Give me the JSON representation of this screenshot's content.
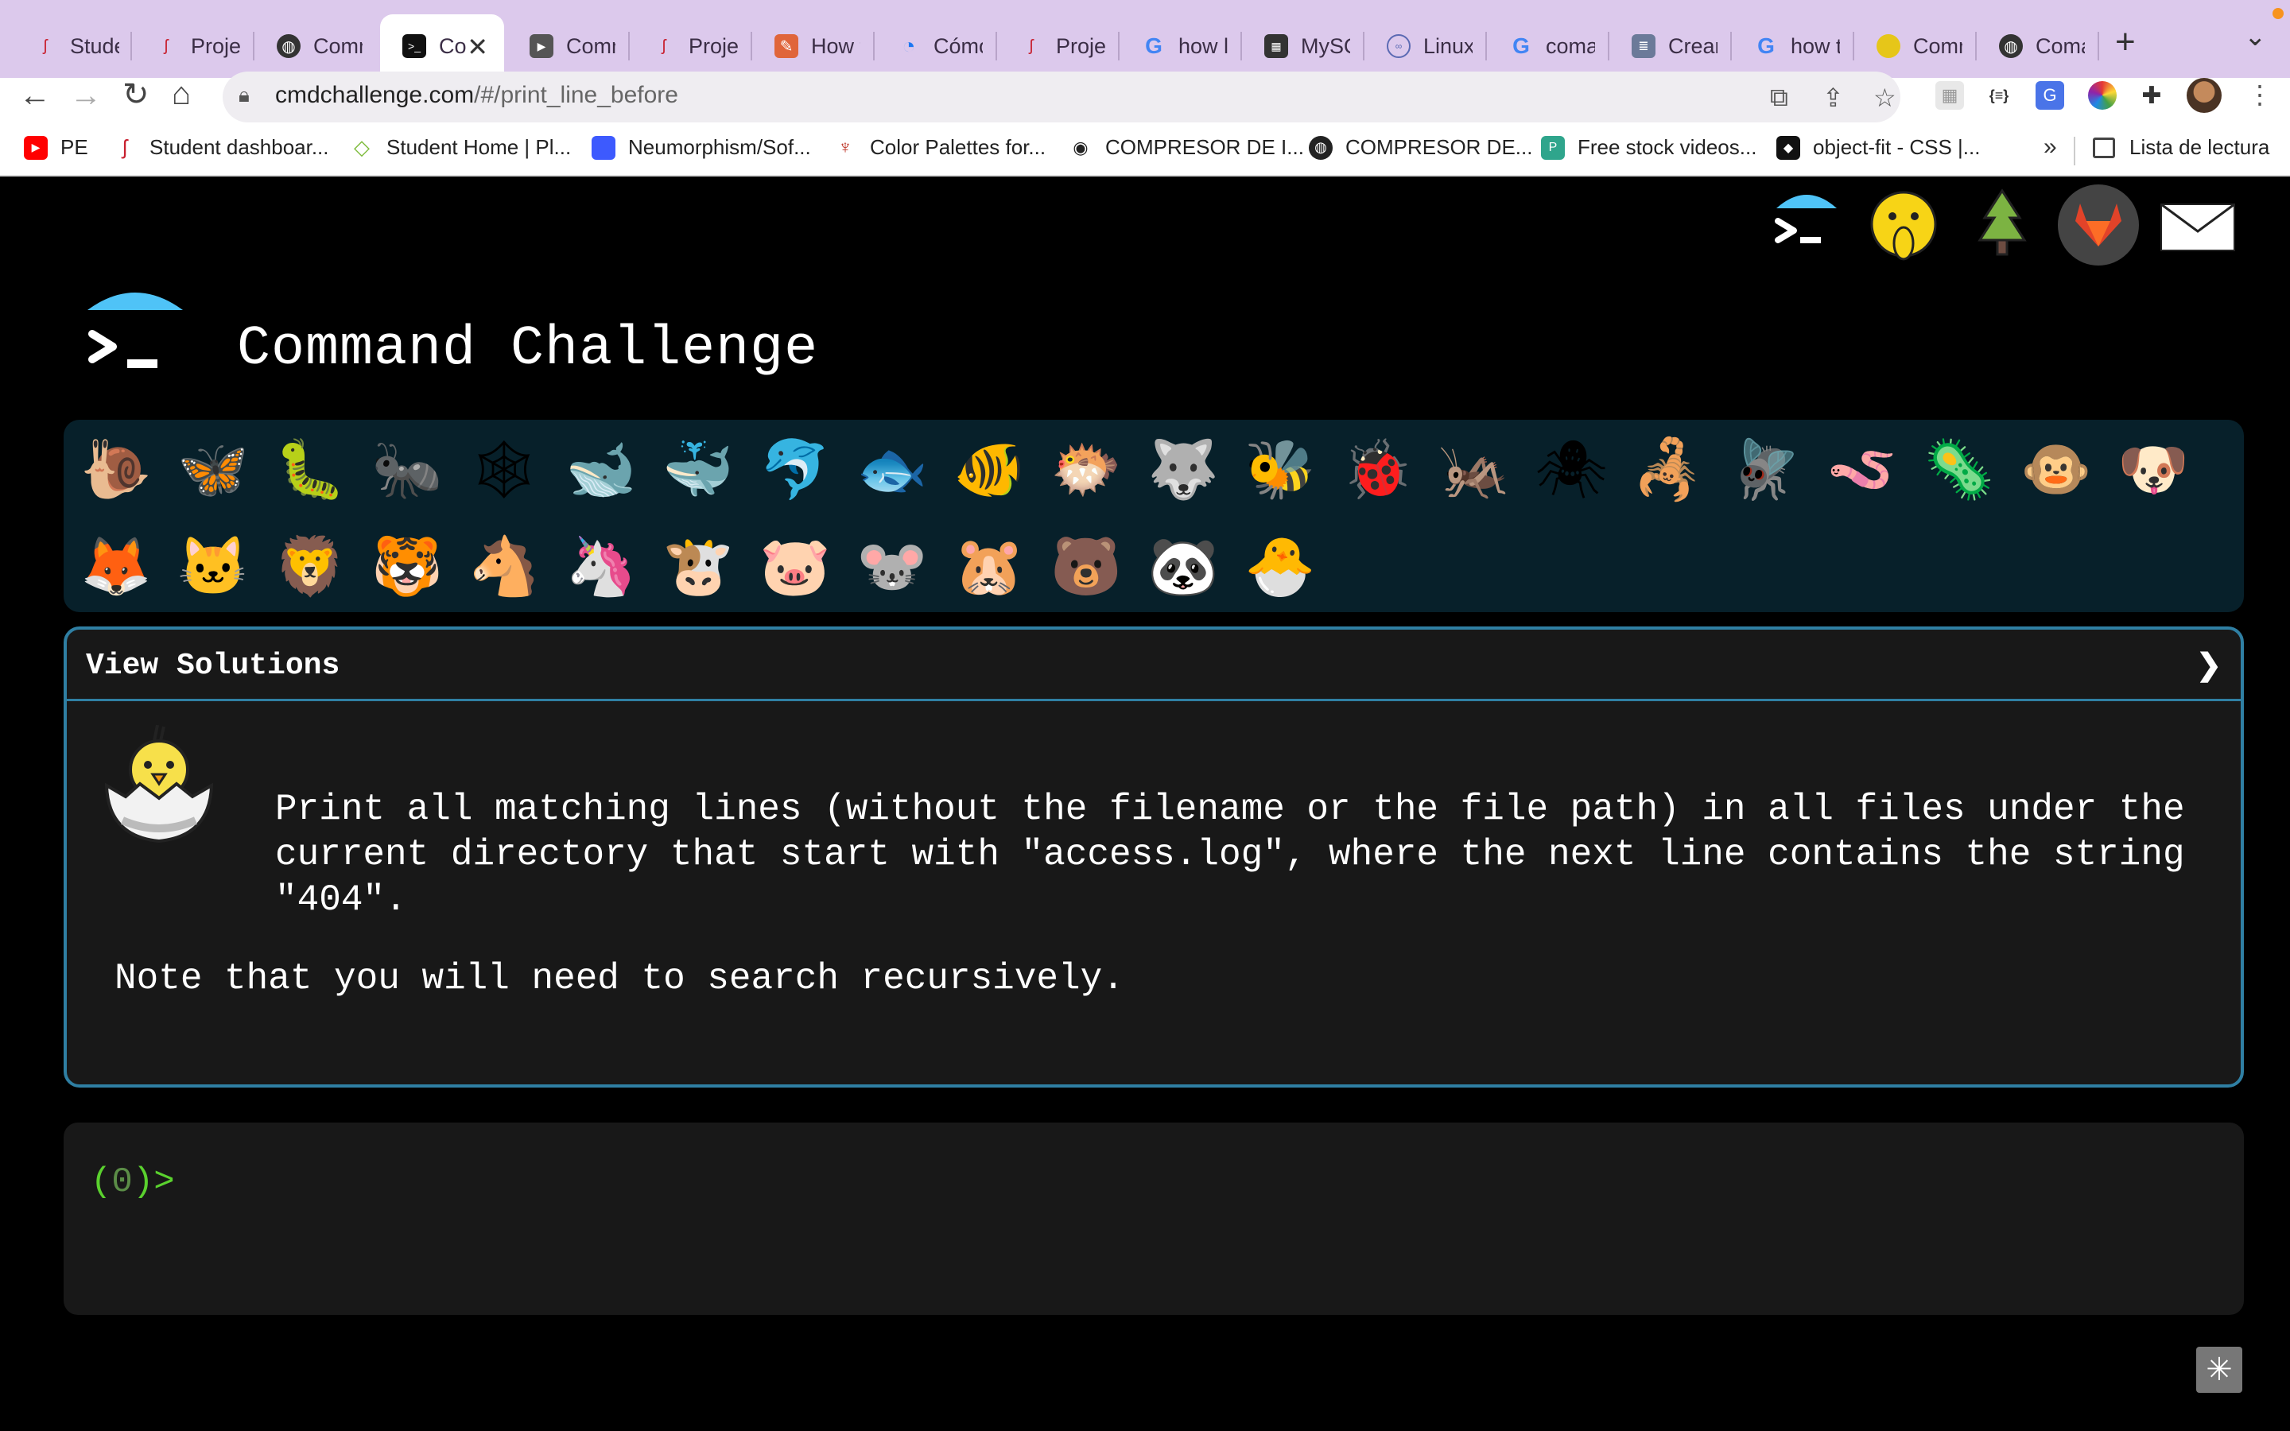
{
  "browser": {
    "tabs": [
      {
        "title": "Studen",
        "icon": "seahorse-icon",
        "color": "#c8202f"
      },
      {
        "title": "Projec",
        "icon": "seahorse-icon",
        "color": "#c8202f"
      },
      {
        "title": "Comm",
        "icon": "globe-icon",
        "color": "#333333"
      },
      {
        "title": "Co",
        "icon": "terminal-icon",
        "color": "#111111",
        "active": true
      },
      {
        "title": "Comm",
        "icon": "play-icon",
        "color": "#555555"
      },
      {
        "title": "Projec",
        "icon": "seahorse-icon",
        "color": "#c8202f"
      },
      {
        "title": "How to",
        "icon": "pen-icon",
        "color": "#e0653a"
      },
      {
        "title": "Cómo",
        "icon": "digitalocean-icon",
        "color": "#1d77f2"
      },
      {
        "title": "Projec",
        "icon": "seahorse-icon",
        "color": "#c8202f"
      },
      {
        "title": "how lis",
        "icon": "google-icon",
        "color": "#4285f4"
      },
      {
        "title": "MySQL",
        "icon": "mysql-icon",
        "color": "#333333"
      },
      {
        "title": "Linux -",
        "icon": "linux-icon",
        "color": "#5b6ab3"
      },
      {
        "title": "coman",
        "icon": "google-icon",
        "color": "#4285f4"
      },
      {
        "title": "Crear c",
        "icon": "doc-icon",
        "color": "#6b7a99"
      },
      {
        "title": "how to",
        "icon": "google-icon",
        "color": "#4285f4"
      },
      {
        "title": "Comm",
        "icon": "chick-icon",
        "color": "#e6c619"
      },
      {
        "title": "Comar",
        "icon": "globe-icon",
        "color": "#333333"
      }
    ],
    "url_host": "cmdchallenge.com",
    "url_path": "/#/print_line_before",
    "bookmarks": [
      {
        "label": "PE",
        "icon": "youtube-icon",
        "color": "#ff0000"
      },
      {
        "label": "Student dashboar...",
        "icon": "seahorse-icon",
        "color": "#c8202f"
      },
      {
        "label": "Student Home | Pl...",
        "icon": "diamond-icon",
        "color": "#7dbb3a"
      },
      {
        "label": "Neumorphism/Sof...",
        "icon": "square-icon",
        "color": "#3d5afe"
      },
      {
        "label": "Color Palettes for...",
        "icon": "cup-icon",
        "color": "#c0392b"
      },
      {
        "label": "COMPRESOR DE I...",
        "icon": "panda-icon",
        "color": "#222222"
      },
      {
        "label": "COMPRESOR DE...",
        "icon": "globe-icon",
        "color": "#222222"
      },
      {
        "label": "Free stock videos...",
        "icon": "pexels-icon",
        "color": "#2fa58c"
      },
      {
        "label": "object-fit - CSS |...",
        "icon": "mdn-icon",
        "color": "#111111"
      }
    ],
    "bookmarks_more": "»",
    "reading_list": "Lista de lectura"
  },
  "site": {
    "title": "Command Challenge"
  },
  "challenge": {
    "solutions_label": "View Solutions",
    "chevron": "❯",
    "task": "Print all matching lines (without the filename or the file path) in all files under the current directory that start with \"access.log\", where the next line contains the string \"404\".",
    "note": "Note that you will need to search recursively."
  },
  "terminal": {
    "prompt_open": "(",
    "exit_code": "0",
    "prompt_close": ")>"
  },
  "colors": {
    "tabbar": "#dcc9ec",
    "accent_border": "#2f7fa3",
    "panel_bg": "#07202a",
    "prompt_green": "#5ad12e"
  }
}
